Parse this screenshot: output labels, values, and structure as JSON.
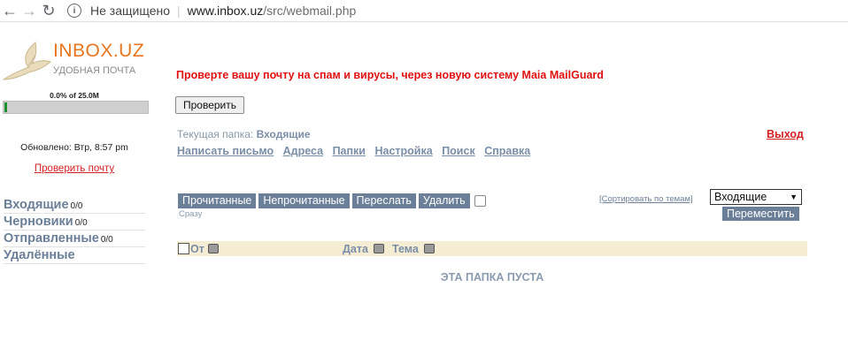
{
  "browser": {
    "security_label": "Не защищено",
    "url_host": "www.inbox.uz",
    "url_path": "/src/webmail.php"
  },
  "logo": {
    "title": "INBOX.UZ",
    "subtitle": "УДОБНАЯ ПОЧТА"
  },
  "quota": {
    "text": "0.0% of 25.0M",
    "used_fraction": 0.0
  },
  "sidebar": {
    "updated": "Обновлено: Втр, 8:57 pm",
    "check_mail": "Проверить почту",
    "folders": [
      {
        "name": "Входящие",
        "count": "0/0"
      },
      {
        "name": "Черновики",
        "count": "0/0"
      },
      {
        "name": "Отправленные",
        "count": "0/0"
      },
      {
        "name": "Удалённые",
        "count": ""
      }
    ]
  },
  "main": {
    "spam_notice": "Проверте вашу почту на спам и вирусы, через новую систему Maia MailGuard",
    "check_button": "Проверить",
    "current_folder_label": "Текущая папка:",
    "current_folder": "Входящие",
    "logout": "Выход",
    "nav": [
      "Написать письмо",
      "Адреса",
      "Папки",
      "Настройка",
      "Поиск",
      "Справка"
    ],
    "actions": [
      "Прочитанные",
      "Непрочитанные",
      "Переслать",
      "Удалить"
    ],
    "immediately": "Сразу",
    "sort_by_threads": "[Сортировать по темам]",
    "move_folder_selected": "Входящие",
    "move_button": "Переместить",
    "columns": {
      "from": "От",
      "date": "Дата",
      "subject": "Тема"
    },
    "empty_message": "ЭТА ПАПКА ПУСТА"
  }
}
